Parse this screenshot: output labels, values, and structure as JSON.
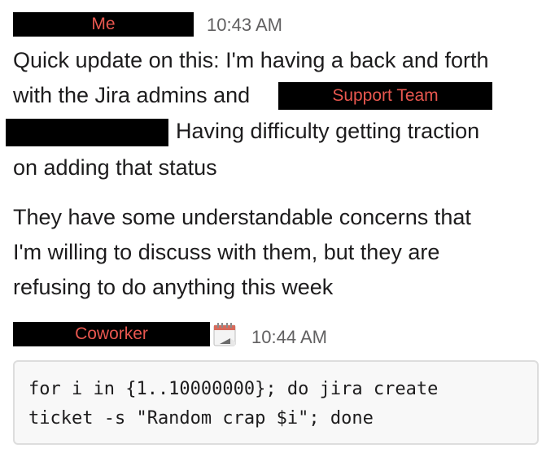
{
  "messages": [
    {
      "sender": "Me",
      "time": "10:43 AM",
      "text_lines": [
        "Quick update on this: I'm having a back and forth",
        "with the Jira admins and",
        "Having difficulty getting traction",
        "on adding that status",
        "They have some understandable concerns that",
        "I'm willing to discuss with them, but they are",
        "refusing to do anything this week"
      ],
      "mention": "Support Team"
    },
    {
      "sender": "Coworker",
      "time": "10:44 AM",
      "code_lines": [
        "for i in {1..10000000}; do jira create",
        "ticket -s \"Random crap $i\"; done"
      ]
    }
  ],
  "icons": {
    "sender2_status": "calendar-icon"
  },
  "colors": {
    "redaction_fill": "#000000",
    "redaction_label": "#e8574f",
    "timestamp": "#616061",
    "text": "#1d1c1d",
    "code_background": "#f8f8f8",
    "code_border": "#dddddd"
  }
}
